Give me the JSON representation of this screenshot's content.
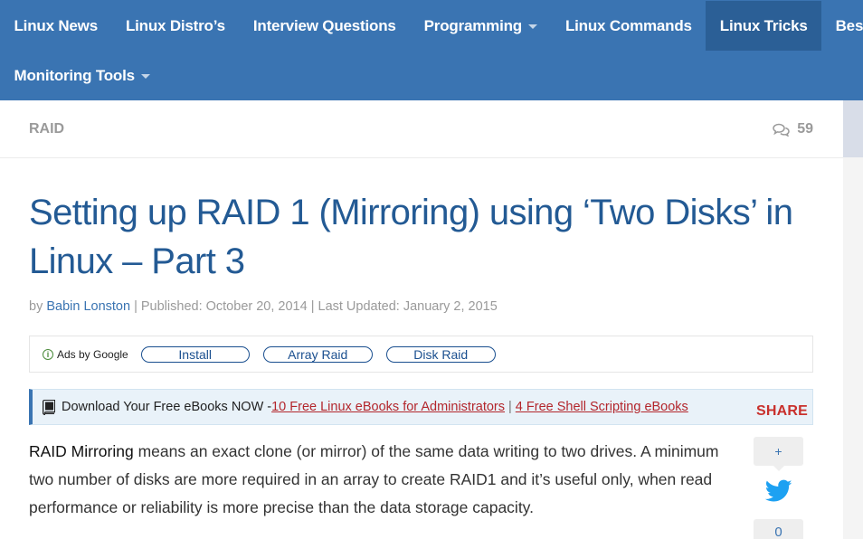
{
  "nav": {
    "row1": [
      {
        "label": "Linux News",
        "caret": false,
        "active": false
      },
      {
        "label": "Linux Distro’s",
        "caret": false,
        "active": false
      },
      {
        "label": "Interview Questions",
        "caret": false,
        "active": false
      },
      {
        "label": "Programming",
        "caret": true,
        "active": false
      },
      {
        "label": "Linux Commands",
        "caret": false,
        "active": false
      },
      {
        "label": "Linux Tricks",
        "caret": false,
        "active": true
      },
      {
        "label": "Best Linux Tools",
        "caret": false,
        "active": false
      }
    ],
    "row2": [
      {
        "label": "Monitoring Tools",
        "caret": true,
        "active": false
      }
    ]
  },
  "category": {
    "label": "RAID",
    "comment_count": "59"
  },
  "article": {
    "title": "Setting up RAID 1 (Mirroring) using ‘Two Disks’ in Linux – Part 3",
    "meta": {
      "by": "by ",
      "author": "Babin Lonston",
      "published": " | Published: October 20, 2014 | Last Updated: January 2, 2015"
    }
  },
  "ads": {
    "label": "Ads by Google",
    "pills": [
      "Install",
      "Array Raid",
      "Disk Raid"
    ]
  },
  "banner": {
    "text": "Download Your Free eBooks NOW - ",
    "link1": "10 Free Linux eBooks for Administrators",
    "sep": "|",
    "link2": "4 Free Shell Scripting eBooks"
  },
  "share": {
    "label": "SHARE",
    "plus": "+",
    "count": "0"
  },
  "paragraph": {
    "strong": "RAID Mirroring",
    "rest": " means an exact clone (or mirror) of the same data writing to two drives. A minimum two number of disks are more required in an array to create RAID1 and it’s useful only, when read performance or reliability is more precise than the data storage capacity."
  },
  "colors": {
    "nav_bg": "#3a74b2",
    "nav_active": "#2b5f96",
    "title": "#235a94",
    "link_red": "#b3262c",
    "share_red": "#c9302c"
  }
}
